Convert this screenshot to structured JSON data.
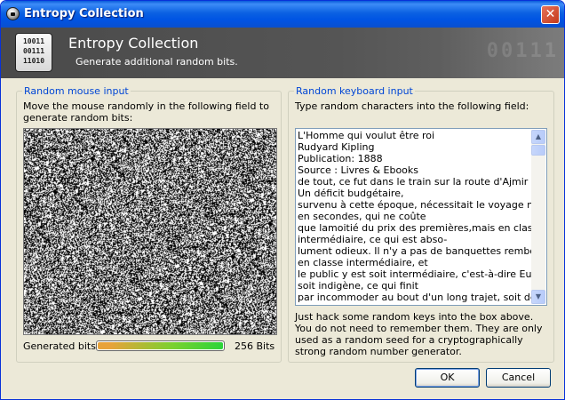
{
  "window": {
    "title": "Entropy Collection",
    "close_label": "✕"
  },
  "header": {
    "icon_lines": [
      "10011",
      "00111",
      "11010"
    ],
    "ghost_digits": "00111",
    "title": "Entropy Collection",
    "subtitle": "Generate additional random bits."
  },
  "mouse": {
    "group_label": "Random mouse input",
    "description": "Move the mouse randomly in the following field to generate random bits:",
    "generated_label": "Generated bits:",
    "progress": 1.0,
    "bits_text": "256 Bits"
  },
  "keyboard": {
    "group_label": "Random keyboard input",
    "description": "Type random characters into the following field:",
    "text_lines": [
      "L'Homme qui voulut être roi",
      "Rudyard Kipling",
      "Publication: 1888",
      "Source : Livres & Ebooks",
      "de tout, ce fut dans le train sur la route d'Ajmir à Mhow.",
      "Un déficit budgétaire,",
      "survenu à cette époque, nécessitait le voyage non pas",
      "en secondes, qui ne coûte",
      "que lamoitié du prix des premières,mais en classe",
      "intermédiaire, ce qui est abso-",
      "lument odieux. Il n'y a pas de banquettes rembourrées",
      "en classe intermédiaire, et",
      "le public y est soit intermédiaire, c'est-à-dire Eurasien,",
      "soit indigène, ce qui finit",
      "par incommoder au bout d'un long trajet, soit de"
    ],
    "help_text": "Just hack some random keys into the box above. You do not need to remember them. They are only used as a random seed for a cryptographically strong random number generator."
  },
  "buttons": {
    "ok": "OK",
    "cancel": "Cancel"
  },
  "colors": {
    "title_bar": "#0054e3",
    "group_label": "#0046d5",
    "dialog_bg": "#ece9d8"
  }
}
